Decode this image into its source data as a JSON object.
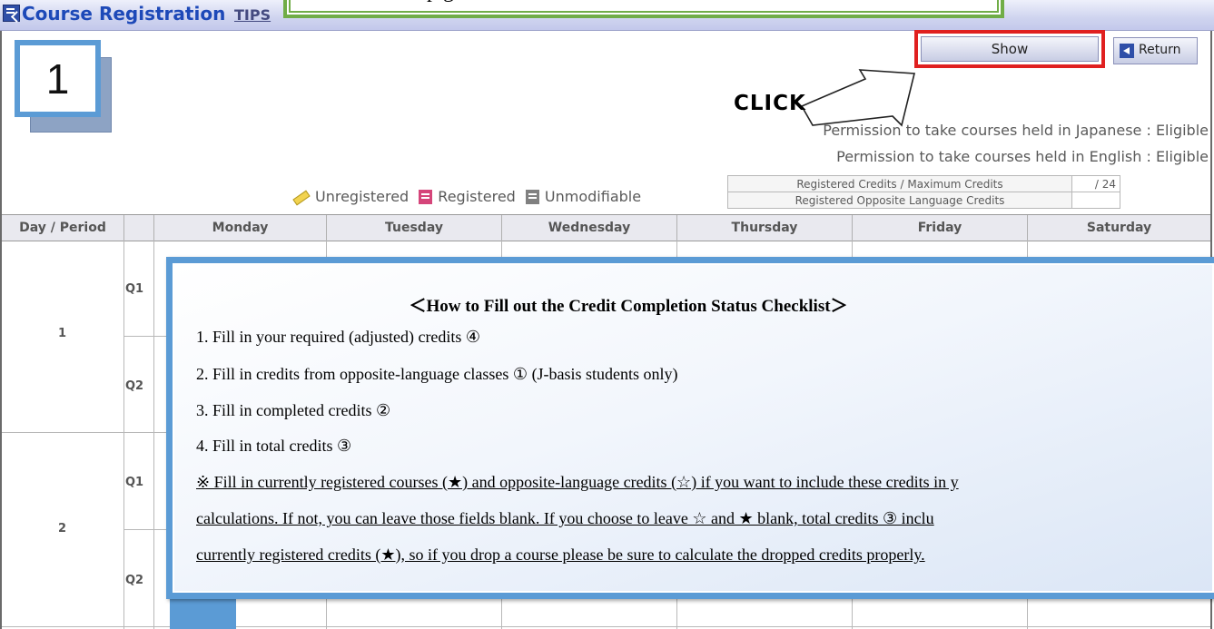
{
  "header": {
    "title": "Course Registration",
    "tips": "TIPS",
    "banner_fragment": "p                                    g"
  },
  "step_number": "1",
  "buttons": {
    "show": "Show",
    "return": "Return"
  },
  "annotation": {
    "click": "CLICK"
  },
  "permissions": {
    "japanese": "Permission to take courses held in Japanese : Eligible",
    "english": "Permission to take courses held in English : Eligible"
  },
  "credits": {
    "registered_max_label": "Registered Credits / Maximum Credits",
    "registered_max_value": "/ 24",
    "opposite_label": "Registered Opposite Language Credits",
    "opposite_value": ""
  },
  "legend": {
    "unregistered": "Unregistered",
    "registered": "Registered",
    "unmodifiable": "Unmodifiable"
  },
  "timetable": {
    "day_period_header": "Day / Period",
    "days": [
      "Monday",
      "Tuesday",
      "Wednesday",
      "Thursday",
      "Friday",
      "Saturday"
    ],
    "periods": [
      {
        "label": "1",
        "quarters": [
          "Q1",
          "Q2"
        ]
      },
      {
        "label": "2",
        "quarters": [
          "Q1",
          "Q2"
        ]
      }
    ]
  },
  "instructions": {
    "title": "＜How to Fill out the   Credit Completion Status Checklist＞",
    "lines": [
      "1. Fill in your required (adjusted) credits  ④",
      "2. Fill in credits from opposite-language classes  ①  (J-basis students only)",
      "3. Fill in completed credits  ②",
      "4. Fill in total credits  ③"
    ],
    "note_lines": [
      "※ Fill in currently registered courses (★) and opposite-language credits (☆) if you want to include these credits in y",
      "calculations. If not, you can leave those fields blank. If you choose to leave ☆ and ★ blank, total credits  ③  inclu",
      "currently registered credits (★), so if you drop a course please be sure to calculate the dropped credits properly."
    ]
  },
  "colors": {
    "header_title": "#1d49b8",
    "highlight_box": "#e02020",
    "overlay_border": "#5b9bd5",
    "banner_border": "#70ad47"
  }
}
